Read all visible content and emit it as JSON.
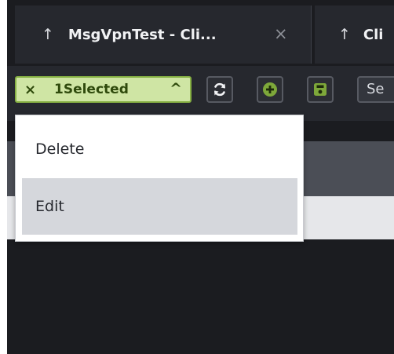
{
  "tabs": [
    {
      "arrow": "↑",
      "label": "MsgVpnTest - Cli...",
      "close": "×"
    },
    {
      "arrow": "↑",
      "label": "Cli"
    }
  ],
  "toolbar": {
    "selection": {
      "clear": "×",
      "label": "1Selected",
      "chevron": "^"
    },
    "refresh_icon": "refresh-icon",
    "add_icon": "add-circle-icon",
    "save_icon": "save-icon",
    "text_button": "Se"
  },
  "menu": {
    "items": [
      "Delete",
      "Edit"
    ]
  },
  "colors": {
    "accent_green": "#86b043",
    "pill_bg": "#cfe5a4",
    "dark_bg": "#1b1c20"
  }
}
